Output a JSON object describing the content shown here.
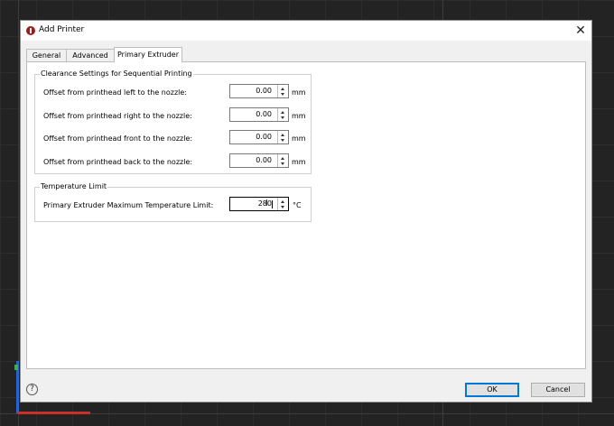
{
  "dialog": {
    "title": "Add Printer",
    "close_icon": "close-icon"
  },
  "tabs": [
    {
      "label": "General"
    },
    {
      "label": "Advanced"
    },
    {
      "label": "Primary Extruder",
      "active": true
    }
  ],
  "clearance": {
    "title": "Clearance Settings for Sequential Printing",
    "rows": [
      {
        "label": "Offset from printhead left to the nozzle:",
        "value": "0.00",
        "unit": "mm"
      },
      {
        "label": "Offset from printhead right to the nozzle:",
        "value": "0.00",
        "unit": "mm"
      },
      {
        "label": "Offset from printhead front to the nozzle:",
        "value": "0.00",
        "unit": "mm"
      },
      {
        "label": "Offset from printhead back to the nozzle:",
        "value": "0.00",
        "unit": "mm"
      }
    ]
  },
  "temperature": {
    "title": "Temperature Limit",
    "label": "Primary Extruder Maximum Temperature Limit:",
    "value": "280",
    "unit": "°C"
  },
  "footer": {
    "help_glyph": "?",
    "ok_label": "OK",
    "cancel_label": "Cancel"
  },
  "colors": {
    "accent": "#0078d7",
    "app_icon": "#9b1c1c"
  }
}
